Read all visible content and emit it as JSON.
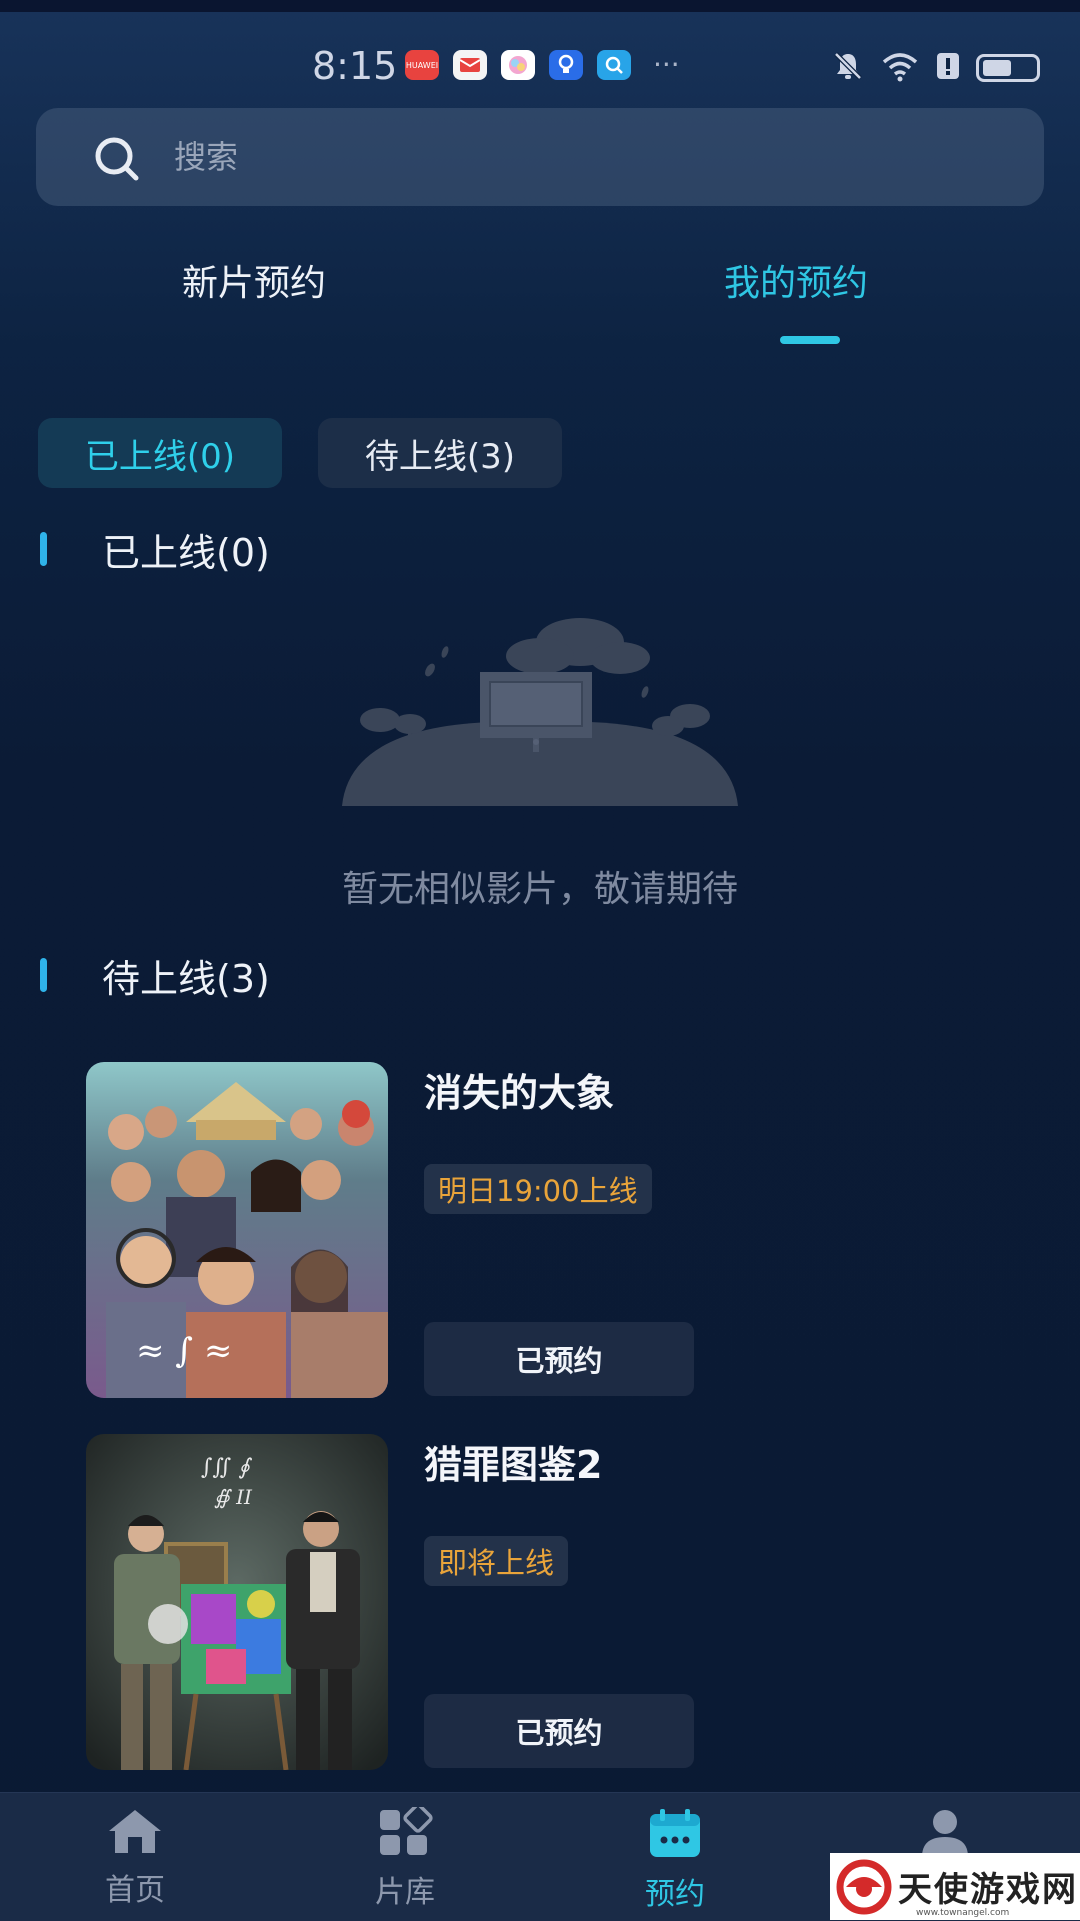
{
  "status_bar": {
    "time": "8:15",
    "app_icons": [
      "huawei-appgallery-icon",
      "mail-icon",
      "gallery-icon",
      "tips-icon",
      "search-app-icon"
    ],
    "app_icon_text": "HUAWEI",
    "more": "···",
    "system_icons": [
      "mute-icon",
      "wifi-icon",
      "notification-icon",
      "battery-icon"
    ]
  },
  "search": {
    "placeholder": "搜索"
  },
  "tabs": [
    {
      "label": "新片预约",
      "active": false
    },
    {
      "label": "我的预约",
      "active": true
    }
  ],
  "filters": [
    {
      "label": "已上线(0)",
      "active": true
    },
    {
      "label": "待上线(3)",
      "active": false
    }
  ],
  "sections": {
    "online": {
      "title": "已上线(0)",
      "empty_text": "暂无相似影片，敬请期待"
    },
    "pending": {
      "title": "待上线(3)",
      "movies": [
        {
          "title": "消失的大象",
          "status": "明日19:00上线",
          "button": "已预约"
        },
        {
          "title": "猎罪图鉴2",
          "status": "即将上线",
          "button": "已预约"
        }
      ]
    }
  },
  "bottom_nav": [
    {
      "label": "首页",
      "icon": "home-icon",
      "active": false
    },
    {
      "label": "片库",
      "icon": "library-icon",
      "active": false
    },
    {
      "label": "预约",
      "icon": "calendar-icon",
      "active": true
    },
    {
      "label": "",
      "icon": "profile-icon",
      "active": false
    }
  ],
  "watermark": {
    "text": "天使游戏网",
    "url": "www.townangel.com"
  },
  "colors": {
    "accent": "#2fc7e4",
    "badge_text": "#e9a43a",
    "background": "#0a1a33"
  }
}
